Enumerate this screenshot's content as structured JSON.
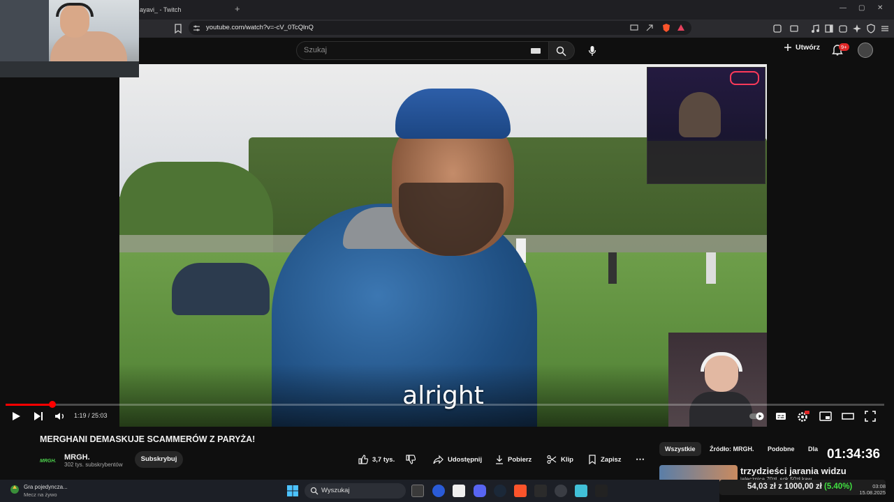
{
  "browser": {
    "tab_title": "ayavi_ - Twitch",
    "new_tab": "+",
    "url": "youtube.com/watch?v=-cV_0TcQlnQ",
    "win_min": "—",
    "win_max": "▢",
    "win_close": "✕"
  },
  "youtube": {
    "search_placeholder": "Szukaj",
    "create_label": "Utwórz",
    "notifications_badge": "9+"
  },
  "video": {
    "subtitle": "alright",
    "time_display": "1:19 / 25:03",
    "progress": 0.053
  },
  "info": {
    "title": "MERGHANI DEMASKUJE SCAMMERÓW Z PARYŻA!",
    "channel_name": "MRGH.",
    "channel_logo": "MRGH.",
    "subscribers": "302 tys. subskrybentów",
    "subscribe_label": "Subskrybuj",
    "like_count": "3,7 tys.",
    "share_label": "Udostępnij",
    "download_label": "Pobierz",
    "clip_label": "Klip",
    "save_label": "Zapisz"
  },
  "chips": [
    "Wszystkie",
    "Źródło: MRGH.",
    "Podobne",
    "Dla C"
  ],
  "stream_overlay": {
    "timer": "01:34:36",
    "rec_title": "trzydzieści jarania widzu",
    "rec_sub": "jalecznica 70zł, sok 50zł kaw",
    "goal_amount": "54,03 zł z 1000,00 zł",
    "goal_pct": "(5.40%)"
  },
  "taskbar": {
    "widget_title": "Gra pojedyncza...",
    "widget_sub": "Mecz na żywo",
    "search_label": "Wyszukaj",
    "clock_time": "03:08",
    "clock_date": "15.08.2025"
  },
  "colors": {
    "progress": "#ff0000",
    "goal_pct": "#40e040",
    "notif_badge": "#e02828"
  }
}
